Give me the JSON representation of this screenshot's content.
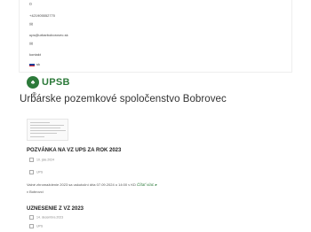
{
  "topbar": {
    "icon_top": "o",
    "phone": "+421905552770",
    "email_icon": "✉",
    "email": "ups@urbarboborovec.sk",
    "contact_icon": "✉",
    "contact_label": "kontakt",
    "lang": {
      "code": "sk",
      "flag_colors": [
        "#ffffff",
        "#1d3e98",
        "#e1252c"
      ]
    }
  },
  "brand": {
    "logo_text": "UPSB",
    "logo_mark": "♣",
    "accent": "#2c7a3a"
  },
  "search_icon": "⊕",
  "site_title": "Urbárske pozemkové spoločenstvo Bobrovec",
  "posts": [
    {
      "title": "POZVÁNKA NA VZ UPS ZA ROK 2023",
      "date": "10. júla 2024",
      "category": "UPS",
      "excerpt": "Valné zhromaždenie 2023 sa uskutoční dňa 07.09.2024 o 14:00 v KD",
      "more": "Čítať viac ▸",
      "place": "v Bobrovci"
    },
    {
      "title": "UZNESENIE Z VZ 2023",
      "date": "14. decembra 2023",
      "category": "UPS"
    }
  ]
}
